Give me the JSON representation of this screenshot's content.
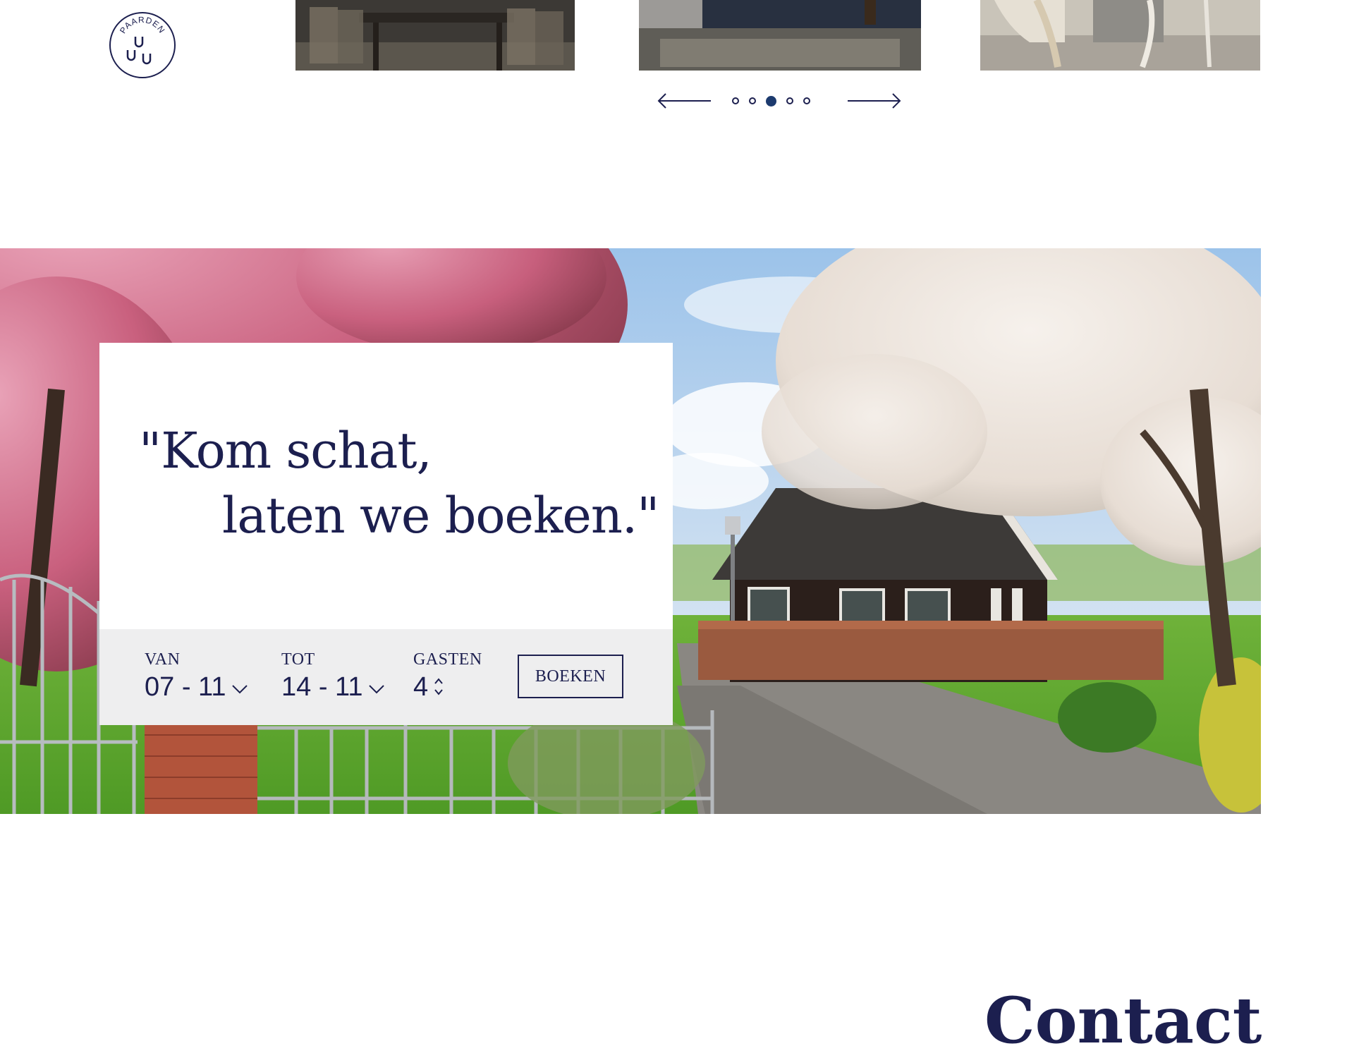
{
  "brand": {
    "logo_text": "PAARDEN",
    "logo_icon": "horseshoe-emblem-icon"
  },
  "gallery": {
    "photos": [
      {
        "subject": "dining-room-photo"
      },
      {
        "subject": "lounge-room-photo"
      },
      {
        "subject": "chairs-room-photo"
      }
    ],
    "prev_icon": "arrow-left-icon",
    "next_icon": "arrow-right-icon",
    "slide_count": 5,
    "active_slide": 3
  },
  "hero": {
    "quote_line_1": "\"Kom schat,",
    "quote_line_2": "laten we boeken.\"",
    "booking": {
      "from_label": "VAN",
      "from_value": "07 - 11",
      "to_label": "TOT",
      "to_value": "14 - 11",
      "guests_label": "GASTEN",
      "guests_value": "4",
      "button_label": "BOEKEN"
    }
  },
  "next_section": {
    "heading_partial": "Contact"
  },
  "colors": {
    "navy": "#1c1f4f",
    "active_dot": "#1c3a6e",
    "booking_bar": "#eeeeef"
  }
}
